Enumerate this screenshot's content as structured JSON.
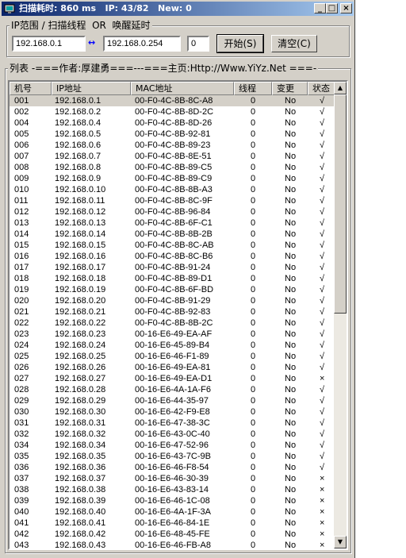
{
  "window": {
    "title": "扫描耗时: 860 ms   IP: 43/82   New: 0",
    "minimize_icon": "minimize-icon",
    "maximize_icon": "maximize-icon",
    "close_icon": "close-icon"
  },
  "scan_group": {
    "legend": "IP范围 / 扫描线程  OR  唤醒延时",
    "start_ip": "192.168.0.1",
    "arrow": "↔",
    "end_ip": "192.168.0.254",
    "threads_value": "0",
    "start_label": "开始(S)",
    "clear_label": "清空(C)"
  },
  "list_group": {
    "legend": "列表 -===作者:厚建勇===---===主页:Http://Www.YiYz.Net ===-"
  },
  "table": {
    "columns": [
      "机号",
      "IP地址",
      "MAC地址",
      "线程",
      "变更",
      "状态"
    ],
    "selected_index": 0,
    "rows": [
      [
        "001",
        "192.168.0.1",
        "00-F0-4C-8B-8C-A8",
        "0",
        "No",
        "√"
      ],
      [
        "002",
        "192.168.0.2",
        "00-F0-4C-8B-8D-2C",
        "0",
        "No",
        "√"
      ],
      [
        "004",
        "192.168.0.4",
        "00-F0-4C-8B-8D-26",
        "0",
        "No",
        "√"
      ],
      [
        "005",
        "192.168.0.5",
        "00-F0-4C-8B-92-81",
        "0",
        "No",
        "√"
      ],
      [
        "006",
        "192.168.0.6",
        "00-F0-4C-8B-89-23",
        "0",
        "No",
        "√"
      ],
      [
        "007",
        "192.168.0.7",
        "00-F0-4C-8B-8E-51",
        "0",
        "No",
        "√"
      ],
      [
        "008",
        "192.168.0.8",
        "00-F0-4C-8B-89-C5",
        "0",
        "No",
        "√"
      ],
      [
        "009",
        "192.168.0.9",
        "00-F0-4C-8B-89-C9",
        "0",
        "No",
        "√"
      ],
      [
        "010",
        "192.168.0.10",
        "00-F0-4C-8B-8B-A3",
        "0",
        "No",
        "√"
      ],
      [
        "011",
        "192.168.0.11",
        "00-F0-4C-8B-8C-9F",
        "0",
        "No",
        "√"
      ],
      [
        "012",
        "192.168.0.12",
        "00-F0-4C-8B-96-84",
        "0",
        "No",
        "√"
      ],
      [
        "013",
        "192.168.0.13",
        "00-F0-4C-8B-6F-C1",
        "0",
        "No",
        "√"
      ],
      [
        "014",
        "192.168.0.14",
        "00-F0-4C-8B-8B-2B",
        "0",
        "No",
        "√"
      ],
      [
        "015",
        "192.168.0.15",
        "00-F0-4C-8B-8C-AB",
        "0",
        "No",
        "√"
      ],
      [
        "016",
        "192.168.0.16",
        "00-F0-4C-8B-8C-B6",
        "0",
        "No",
        "√"
      ],
      [
        "017",
        "192.168.0.17",
        "00-F0-4C-8B-91-24",
        "0",
        "No",
        "√"
      ],
      [
        "018",
        "192.168.0.18",
        "00-F0-4C-8B-89-D1",
        "0",
        "No",
        "√"
      ],
      [
        "019",
        "192.168.0.19",
        "00-F0-4C-8B-6F-BD",
        "0",
        "No",
        "√"
      ],
      [
        "020",
        "192.168.0.20",
        "00-F0-4C-8B-91-29",
        "0",
        "No",
        "√"
      ],
      [
        "021",
        "192.168.0.21",
        "00-F0-4C-8B-92-83",
        "0",
        "No",
        "√"
      ],
      [
        "022",
        "192.168.0.22",
        "00-F0-4C-8B-8B-2C",
        "0",
        "No",
        "√"
      ],
      [
        "023",
        "192.168.0.23",
        "00-16-E6-49-EA-AF",
        "0",
        "No",
        "√"
      ],
      [
        "024",
        "192.168.0.24",
        "00-16-E6-45-89-B4",
        "0",
        "No",
        "√"
      ],
      [
        "025",
        "192.168.0.25",
        "00-16-E6-46-F1-89",
        "0",
        "No",
        "√"
      ],
      [
        "026",
        "192.168.0.26",
        "00-16-E6-49-EA-81",
        "0",
        "No",
        "√"
      ],
      [
        "027",
        "192.168.0.27",
        "00-16-E6-49-EA-D1",
        "0",
        "No",
        "×"
      ],
      [
        "028",
        "192.168.0.28",
        "00-16-E6-4A-1A-F6",
        "0",
        "No",
        "√"
      ],
      [
        "029",
        "192.168.0.29",
        "00-16-E6-44-35-97",
        "0",
        "No",
        "√"
      ],
      [
        "030",
        "192.168.0.30",
        "00-16-E6-42-F9-E8",
        "0",
        "No",
        "√"
      ],
      [
        "031",
        "192.168.0.31",
        "00-16-E6-47-38-3C",
        "0",
        "No",
        "√"
      ],
      [
        "032",
        "192.168.0.32",
        "00-16-E6-43-0C-40",
        "0",
        "No",
        "√"
      ],
      [
        "034",
        "192.168.0.34",
        "00-16-E6-47-52-96",
        "0",
        "No",
        "√"
      ],
      [
        "035",
        "192.168.0.35",
        "00-16-E6-43-7C-9B",
        "0",
        "No",
        "√"
      ],
      [
        "036",
        "192.168.0.36",
        "00-16-E6-46-F8-54",
        "0",
        "No",
        "√"
      ],
      [
        "037",
        "192.168.0.37",
        "00-16-E6-46-30-39",
        "0",
        "No",
        "×"
      ],
      [
        "038",
        "192.168.0.38",
        "00-16-E6-43-83-14",
        "0",
        "No",
        "×"
      ],
      [
        "039",
        "192.168.0.39",
        "00-16-E6-46-1C-08",
        "0",
        "No",
        "×"
      ],
      [
        "040",
        "192.168.0.40",
        "00-16-E6-4A-1F-3A",
        "0",
        "No",
        "×"
      ],
      [
        "041",
        "192.168.0.41",
        "00-16-E6-46-84-1E",
        "0",
        "No",
        "×"
      ],
      [
        "042",
        "192.168.0.42",
        "00-16-E6-48-45-FE",
        "0",
        "No",
        "×"
      ],
      [
        "043",
        "192.168.0.43",
        "00-16-E6-46-FB-A8",
        "0",
        "No",
        "×"
      ]
    ]
  },
  "colors": {
    "title_gradient_start": "#0a246a",
    "title_gradient_end": "#a6caf0",
    "face": "#d4d0c8",
    "arrow": "#0000ff"
  }
}
